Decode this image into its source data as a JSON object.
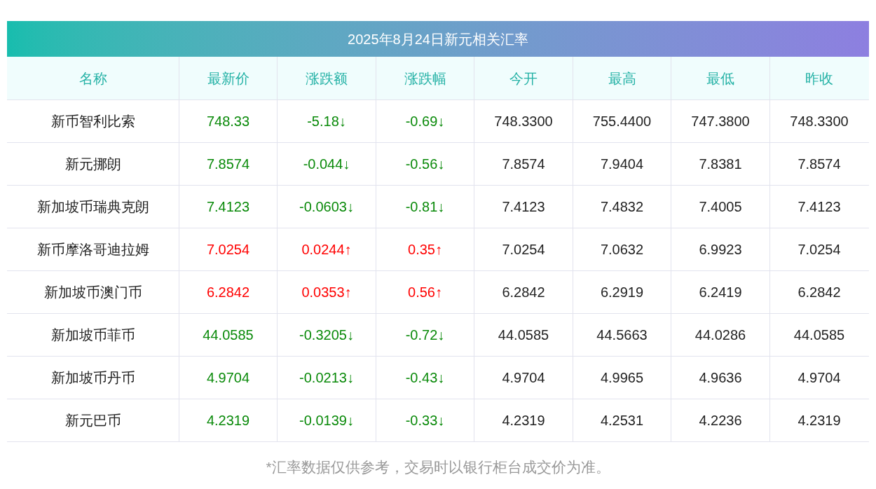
{
  "title": "2025年8月24日新元相关汇率",
  "columns": [
    "名称",
    "最新价",
    "涨跌额",
    "涨跌幅",
    "今开",
    "最高",
    "最低",
    "昨收"
  ],
  "rows": [
    {
      "name": "新币智利比索",
      "price": "748.33",
      "change": "-5.18↓",
      "pct": "-0.69↓",
      "open": "748.3300",
      "high": "755.4400",
      "low": "747.3800",
      "prev": "748.3300",
      "color": "#0a8a0a"
    },
    {
      "name": "新元挪朗",
      "price": "7.8574",
      "change": "-0.044↓",
      "pct": "-0.56↓",
      "open": "7.8574",
      "high": "7.9404",
      "low": "7.8381",
      "prev": "7.8574",
      "color": "#0a8a0a"
    },
    {
      "name": "新加坡币瑞典克朗",
      "price": "7.4123",
      "change": "-0.0603↓",
      "pct": "-0.81↓",
      "open": "7.4123",
      "high": "7.4832",
      "low": "7.4005",
      "prev": "7.4123",
      "color": "#0a8a0a"
    },
    {
      "name": "新币摩洛哥迪拉姆",
      "price": "7.0254",
      "change": "0.0244↑",
      "pct": "0.35↑",
      "open": "7.0254",
      "high": "7.0632",
      "low": "6.9923",
      "prev": "7.0254",
      "color": "#ff0000"
    },
    {
      "name": "新加坡币澳门币",
      "price": "6.2842",
      "change": "0.0353↑",
      "pct": "0.56↑",
      "open": "6.2842",
      "high": "6.2919",
      "low": "6.2419",
      "prev": "6.2842",
      "color": "#ff0000"
    },
    {
      "name": "新加坡币菲币",
      "price": "44.0585",
      "change": "-0.3205↓",
      "pct": "-0.72↓",
      "open": "44.0585",
      "high": "44.5663",
      "low": "44.0286",
      "prev": "44.0585",
      "color": "#0a8a0a"
    },
    {
      "name": "新加坡币丹币",
      "price": "4.9704",
      "change": "-0.0213↓",
      "pct": "-0.43↓",
      "open": "4.9704",
      "high": "4.9965",
      "low": "4.9636",
      "prev": "4.9704",
      "color": "#0a8a0a"
    },
    {
      "name": "新元巴币",
      "price": "4.2319",
      "change": "-0.0139↓",
      "pct": "-0.33↓",
      "open": "4.2319",
      "high": "4.2531",
      "low": "4.2236",
      "prev": "4.2319",
      "color": "#0a8a0a"
    }
  ],
  "footnote": "*汇率数据仅供参考，交易时以银行柜台成交价为准。"
}
